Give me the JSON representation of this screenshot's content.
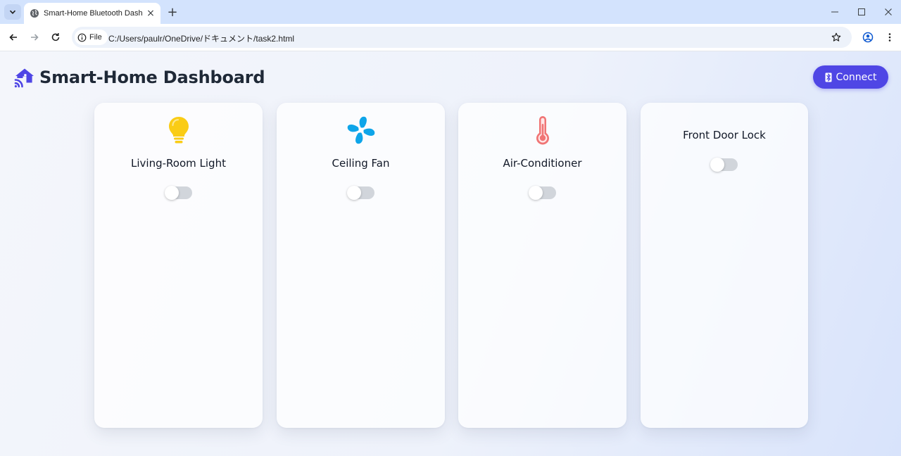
{
  "browser": {
    "tab_title": "Smart-Home Bluetooth Dashboard",
    "new_tab_symbol": "+",
    "close_symbol": "×",
    "file_chip_label": "File",
    "url": "C:/Users/paulr/OneDrive/ドキュメント/task2.html",
    "window_controls": [
      "–",
      "☐",
      "✕"
    ]
  },
  "header": {
    "title": "Smart-Home Dashboard",
    "connect_label": "Connect",
    "accent_color": "#4f46e5"
  },
  "devices": [
    {
      "name": "Living-Room Light",
      "icon": "lightbulb-icon",
      "icon_color": "#facc15",
      "on": false
    },
    {
      "name": "Ceiling Fan",
      "icon": "fan-icon",
      "icon_color": "#0ea5e9",
      "on": false
    },
    {
      "name": "Air-Conditioner",
      "icon": "thermometer-icon",
      "icon_color": "#f07575",
      "on": false
    },
    {
      "name": "Front Door Lock",
      "icon": null,
      "on": false
    }
  ]
}
